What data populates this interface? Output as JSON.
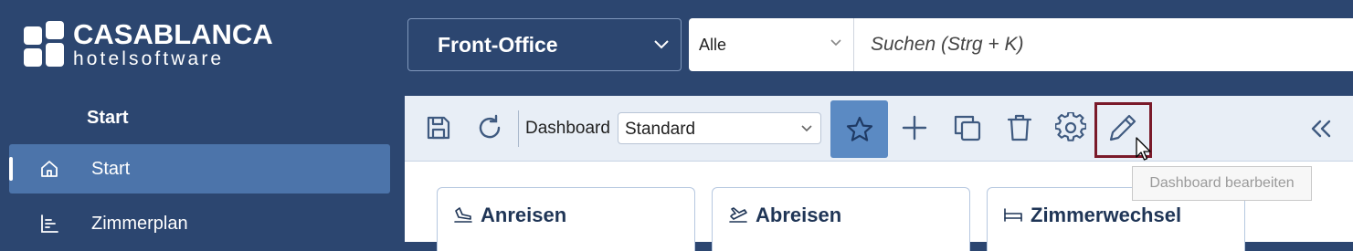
{
  "brand": {
    "line1": "CASABLANCA",
    "line2": "hotelsoftware"
  },
  "sidebar": {
    "section_title": "Start",
    "items": [
      {
        "label": "Start",
        "icon": "home-icon",
        "active": true
      },
      {
        "label": "Zimmerplan",
        "icon": "room-plan-icon",
        "active": false
      }
    ]
  },
  "topbar": {
    "module_select": "Front-Office",
    "search_scope": "Alle",
    "search_placeholder": "Suchen (Strg + K)"
  },
  "toolbar": {
    "dashboard_label": "Dashboard",
    "dashboard_select": "Standard",
    "icons": [
      "save-icon",
      "refresh-icon",
      "star-icon",
      "plus-icon",
      "copy-icon",
      "trash-icon",
      "gear-icon",
      "pencil-icon",
      "double-chevron-left-icon"
    ]
  },
  "tooltip": {
    "text": "Dashboard bearbeiten"
  },
  "cards": [
    {
      "title": "Anreisen",
      "icon": "arrival-icon"
    },
    {
      "title": "Abreisen",
      "icon": "departure-icon"
    },
    {
      "title": "Zimmerwechsel",
      "icon": "bed-icon"
    }
  ],
  "colors": {
    "sidebar_bg": "#2c4670",
    "nav_active": "#4c74aa",
    "star_button": "#5b8ac3",
    "highlight_border": "#7a1a2a",
    "toolbar_bg": "#e8eef6"
  }
}
